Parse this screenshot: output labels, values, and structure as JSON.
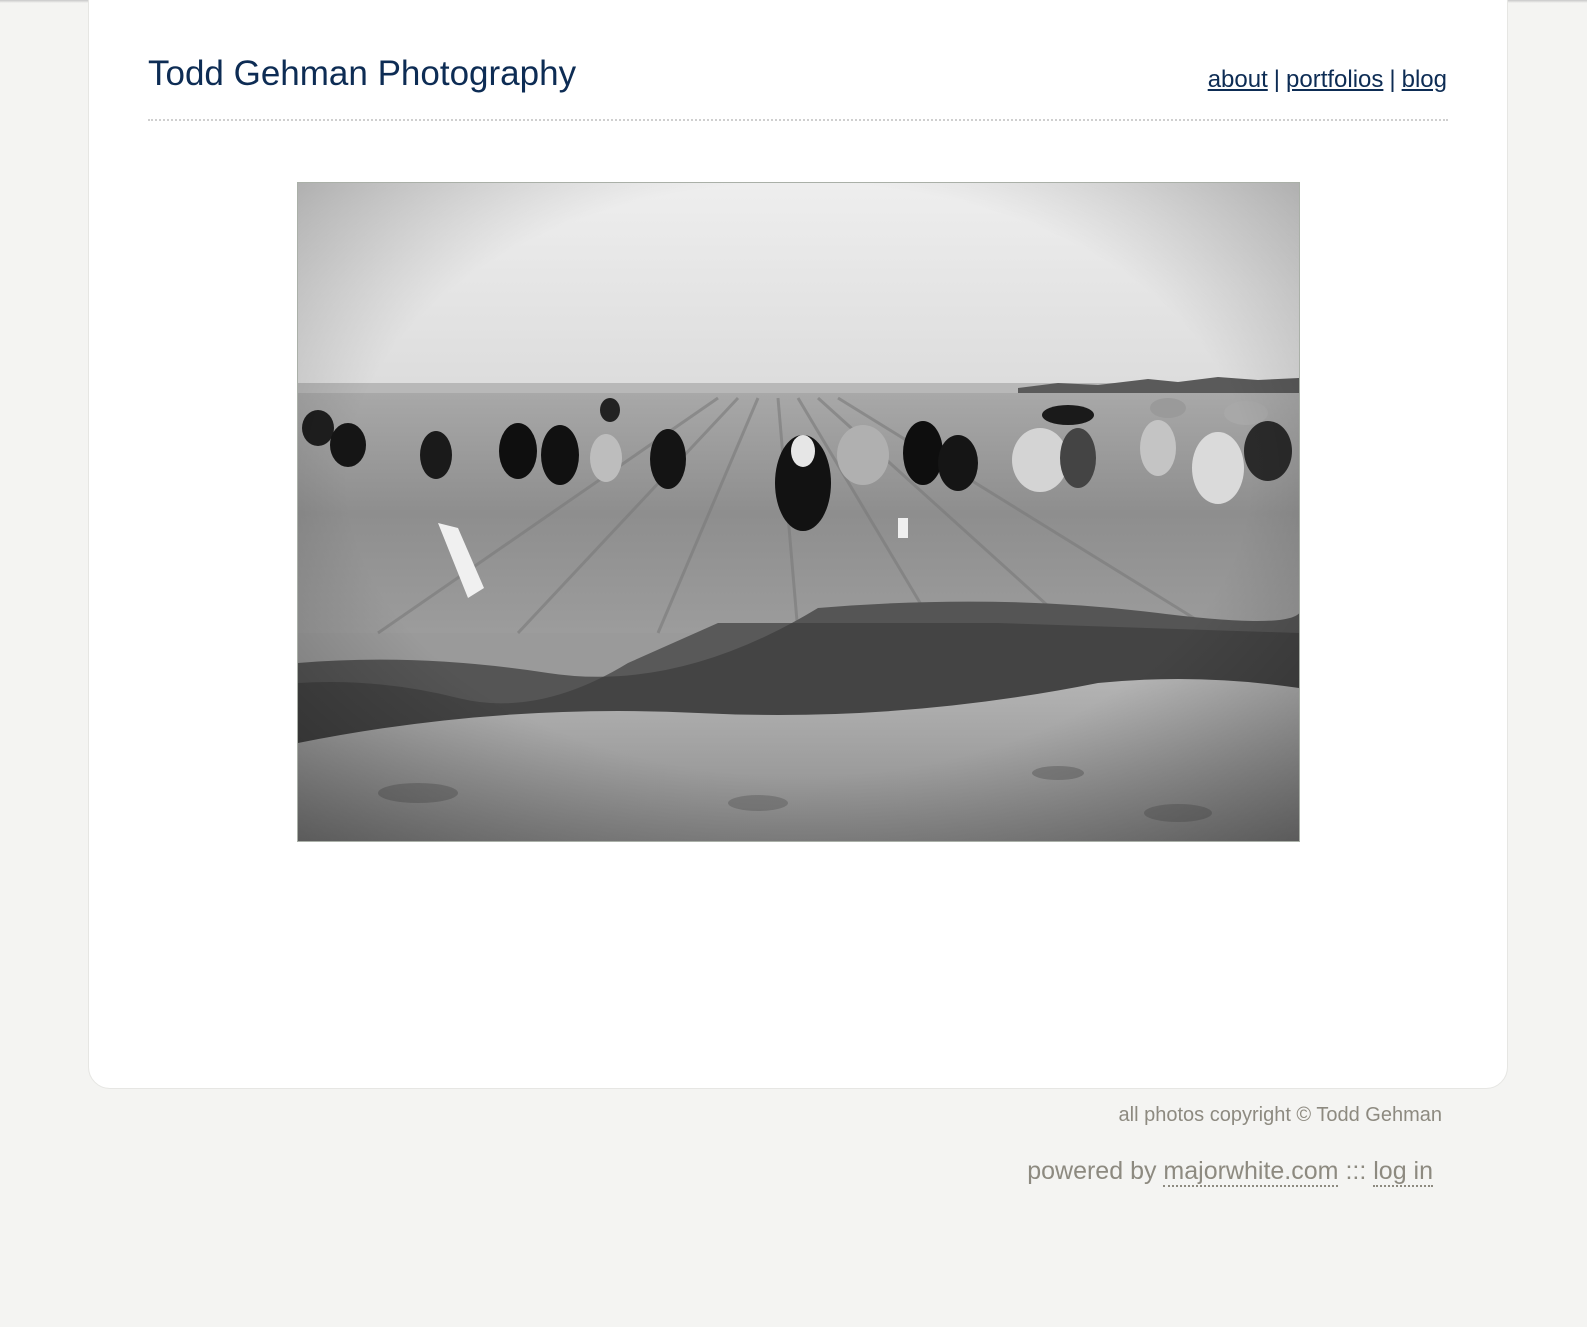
{
  "header": {
    "site_title": "Todd Gehman Photography",
    "nav": [
      {
        "label": "about"
      },
      {
        "label": "portfolios"
      },
      {
        "label": "blog"
      }
    ],
    "nav_separator": "|"
  },
  "main": {
    "photo": {
      "icon": "photo-image",
      "style": "black-and-white"
    }
  },
  "footer": {
    "copyright": "all photos copyright © Todd Gehman",
    "powered_prefix": "powered by",
    "powered_link": "majorwhite.com",
    "powered_separator": ":::",
    "login_link": "log in"
  },
  "colors": {
    "background": "#f4f4f2",
    "card": "#ffffff",
    "title_and_nav": "#0d2c54",
    "footer_text": "#8d8a80"
  }
}
